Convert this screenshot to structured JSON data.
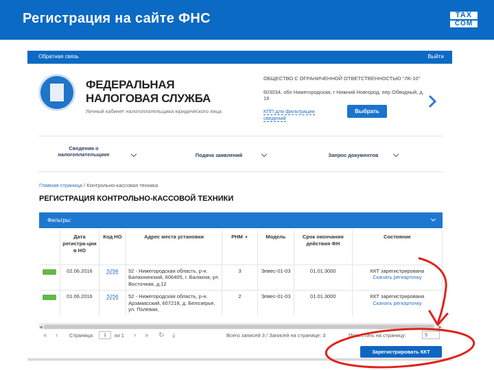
{
  "slide": {
    "title": "Регистрация на сайте ФНС",
    "logo_top": "TAX",
    "logo_bottom": "COM"
  },
  "topbar": {
    "feedback": "Обратная связь",
    "exit": "Выйти"
  },
  "header": {
    "title_line1": "ФЕДЕРАЛЬНАЯ",
    "title_line2": "НАЛОГОВАЯ СЛУЖБА",
    "subtitle": "Личный кабинет налогоплательщика юридического лица",
    "org_name": "ОБЩЕСТВО С ОГРАНИЧЕННОЙ ОТВЕТСТВЕННОСТЬЮ \"ЛК-10\"",
    "org_address": "603034, обл Нижегородская, г Нижний Новгород, пер Обводный, д. 19",
    "kpp_link": "КПП для фильтрации",
    "kpp_value": "сведений",
    "select_button": "Выбрать"
  },
  "nav": [
    {
      "label_line1": "Сведения о",
      "label_line2": "налогоплательщике"
    },
    {
      "label_line1": "Подача заявлений",
      "label_line2": ""
    },
    {
      "label_line1": "Запрос документов",
      "label_line2": ""
    }
  ],
  "breadcrumb": {
    "home": "Главная страница",
    "sep": " / ",
    "current": "Контрольно-кассовая техника"
  },
  "page_title": "РЕГИСТРАЦИЯ КОНТРОЛЬНО-КАССОВОЙ ТЕХНИКИ",
  "filters_label": "Фильтры:",
  "table": {
    "headers": [
      "",
      "Дата регистра-ции в НО",
      "Код НО",
      "Адрес места установки",
      "РНМ",
      "Модель",
      "Срок окончания действия ФН",
      "Состояние"
    ],
    "rows": [
      {
        "status_color": "#64b848",
        "date": "02.06.2016",
        "code": "5258",
        "address": "52 - Нижегородская область, р-н. Балахнинский, 606405, г. Балахна, ул. Восточная, д.12",
        "rnm": "3",
        "model": "Элвес-01-03",
        "fn_end": "01.01.3000",
        "state": "ККТ зарегистрирована",
        "state_link": "Скачать регкарточку"
      },
      {
        "status_color": "#64b848",
        "date": "01.06.2016",
        "code": "5258",
        "address": "52 - Нижегородская область, р-н. Арзамасский, 607218, д. Белозерье, ул. Полевая,",
        "rnm": "2",
        "model": "Элвес-01-03",
        "fn_end": "01.01.3000",
        "state": "ККТ зарегистрирована",
        "state_link": "Скачать регкарточку"
      }
    ]
  },
  "pager": {
    "page_label": "Страница",
    "page_value": "1",
    "of_label": "из 1",
    "summary": "Всего записей 3 / Записей на странице: 3",
    "per_page_label": "Поместить на страницу:",
    "per_page_value": "5"
  },
  "register_button": "Зарегистрировать ККТ"
}
